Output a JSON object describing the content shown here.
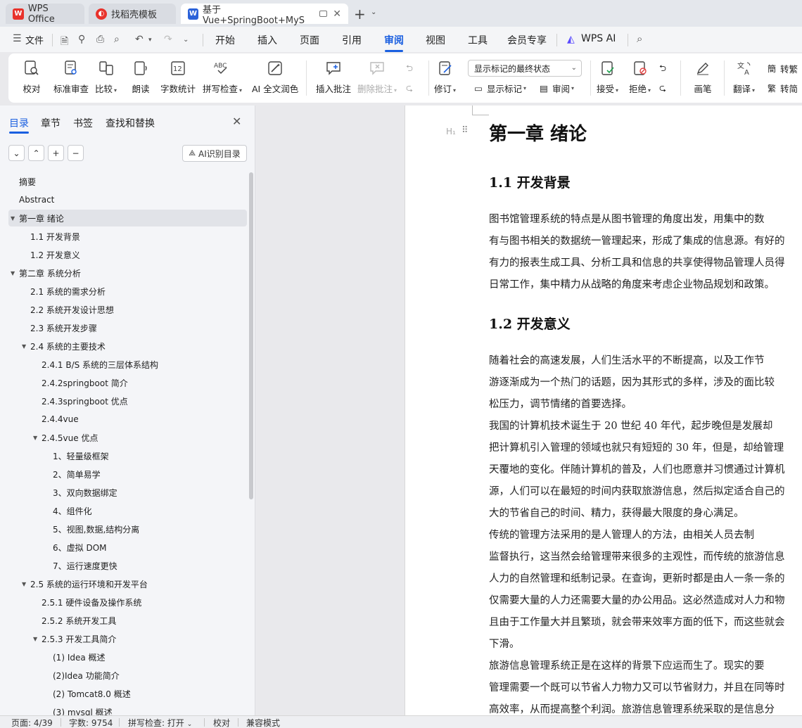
{
  "tabs": [
    {
      "label": "WPS Office",
      "icon": "wps-logo-icon",
      "color": "#e8322b"
    },
    {
      "label": "找稻壳模板",
      "icon": "docer-logo-icon",
      "color": "#e8322b"
    },
    {
      "label": "基于Vue+SpringBoot+MyS",
      "icon": "word-doc-icon",
      "color": "#2b62d9"
    }
  ],
  "menu": {
    "file": "文件",
    "items": [
      "开始",
      "插入",
      "页面",
      "引用",
      "审阅",
      "视图",
      "工具",
      "会员专享"
    ],
    "active": "审阅",
    "wps_ai": "WPS AI"
  },
  "ribbon": {
    "proofread": "校对",
    "standard_review": "标准审查",
    "compare": "比较",
    "read_aloud": "朗读",
    "word_count": "字数统计",
    "spell_check": "拼写检查",
    "ai_polish": "AI 全文润色",
    "insert_comment": "插入批注",
    "delete_comment": "删除批注",
    "revise": "修订",
    "markup_select": "显示标记的最终状态",
    "show_markup": "显示标记",
    "review_pane": "审阅",
    "accept": "接受",
    "reject": "拒绝",
    "pen": "画笔",
    "translate": "翻译",
    "to_traditional": "转繁",
    "to_simplified": "转简"
  },
  "nav": {
    "tabs": [
      "目录",
      "章节",
      "书签",
      "查找和替换"
    ],
    "active_tab": "目录",
    "ai_toc": "AI识别目录",
    "toc": [
      {
        "label": "摘要",
        "level": 1,
        "arrow": false
      },
      {
        "label": "Abstract",
        "level": 1,
        "arrow": false
      },
      {
        "label": "第一章  绪论",
        "level": 1,
        "arrow": true,
        "selected": true
      },
      {
        "label": "1.1  开发背景",
        "level": 2,
        "arrow": false
      },
      {
        "label": "1.2  开发意义",
        "level": 2,
        "arrow": false
      },
      {
        "label": "第二章  系统分析",
        "level": 1,
        "arrow": true
      },
      {
        "label": "2.1  系统的需求分析",
        "level": 2,
        "arrow": false
      },
      {
        "label": "2.2  系统开发设计思想",
        "level": 2,
        "arrow": false
      },
      {
        "label": "2.3 系统开发步骤",
        "level": 2,
        "arrow": false
      },
      {
        "label": "2.4  系统的主要技术",
        "level": 2,
        "arrow": true
      },
      {
        "label": "2.4.1 B/S 系统的三层体系结构",
        "level": 3,
        "arrow": false
      },
      {
        "label": "2.4.2springboot 简介",
        "level": 3,
        "arrow": false
      },
      {
        "label": "2.4.3springboot 优点",
        "level": 3,
        "arrow": false
      },
      {
        "label": "2.4.4vue",
        "level": 3,
        "arrow": false
      },
      {
        "label": "2.4.5vue 优点",
        "level": 3,
        "arrow": true
      },
      {
        "label": "1、轻量级框架",
        "level": 4,
        "arrow": false
      },
      {
        "label": "2、简单易学",
        "level": 4,
        "arrow": false
      },
      {
        "label": "3、双向数据绑定",
        "level": 4,
        "arrow": false
      },
      {
        "label": "4、组件化",
        "level": 4,
        "arrow": false
      },
      {
        "label": "5、视图,数据,结构分离",
        "level": 4,
        "arrow": false
      },
      {
        "label": "6、虚拟 DOM",
        "level": 4,
        "arrow": false
      },
      {
        "label": "7、运行速度更快",
        "level": 4,
        "arrow": false
      },
      {
        "label": "2.5  系统的运行环境和开发平台",
        "level": 2,
        "arrow": true
      },
      {
        "label": "2.5.1  硬件设备及操作系统",
        "level": 3,
        "arrow": false
      },
      {
        "label": "2.5.2  系统开发工具",
        "level": 3,
        "arrow": false
      },
      {
        "label": "2.5.3  开发工具简介",
        "level": 3,
        "arrow": true
      },
      {
        "label": "(1) Idea 概述",
        "level": 4,
        "arrow": false
      },
      {
        "label": "(2)Idea 功能简介",
        "level": 4,
        "arrow": false
      },
      {
        "label": "(2) Tomcat8.0 概述",
        "level": 4,
        "arrow": false
      },
      {
        "label": "(3) mysql 概述",
        "level": 4,
        "arrow": false
      }
    ]
  },
  "document": {
    "h1": "第一章  绪论",
    "h2_1": "1.1  开发背景",
    "para1": [
      "    图书馆管理系统的特点是从图书管理的角度出发，用集中的数",
      "有与图书相关的数据统一管理起来，形成了集成的信息源。有好的",
      "有力的报表生成工具、分析工具和信息的共享使得物品管理人员得",
      "日常工作，集中精力从战略的角度来考虑企业物品规划和政策。"
    ],
    "h2_2": "1.2  开发意义",
    "para2": [
      "    随着社会的高速发展，人们生活水平的不断提高，以及工作节",
      "游逐渐成为一个热门的话题，因为其形式的多样，涉及的面比较",
      "松压力，调节情绪的首要选择。",
      "    我国的计算机技术诞生于 20 世纪 40 年代，起步晚但是发展却",
      "把计算机引入管理的领域也就只有短短的 30 年，但是，却给管理",
      "天覆地的变化。伴随计算机的普及，人们也愿意并习惯通过计算机",
      "源，人们可以在最短的时间内获取旅游信息，然后拟定适合自己的",
      "大的节省自己的时间、精力，获得最大限度的身心满足。",
      "    传统的管理方法采用的是人管理人的方法，由相关人员去制",
      "监督执行，这当然会给管理带来很多的主观性，而传统的旅游信息",
      "人力的自然管理和纸制记录。在查询，更新时都是由人一条一条的",
      "仅需要大量的人力还需要大量的办公用品。这必然造成对人力和物",
      "且由于工作量大并且繁琐，就会带来效率方面的低下，而这些就会",
      "下滑。",
      "    旅游信息管理系统正是在这样的背景下应运而生了。现实的要",
      "管理需要一个既可以节省人力物力又可以节省财力，并且在同等时",
      "高效率，从而提高整个利润。旅游信息管理系统采取的是信息分"
    ]
  },
  "status": {
    "page": "页面: 4/39",
    "words": "字数: 9754",
    "spell": "拼写检查: 打开",
    "proof": "校对",
    "compat": "兼容模式"
  },
  "colors": {
    "accent": "#1a5fe0"
  }
}
